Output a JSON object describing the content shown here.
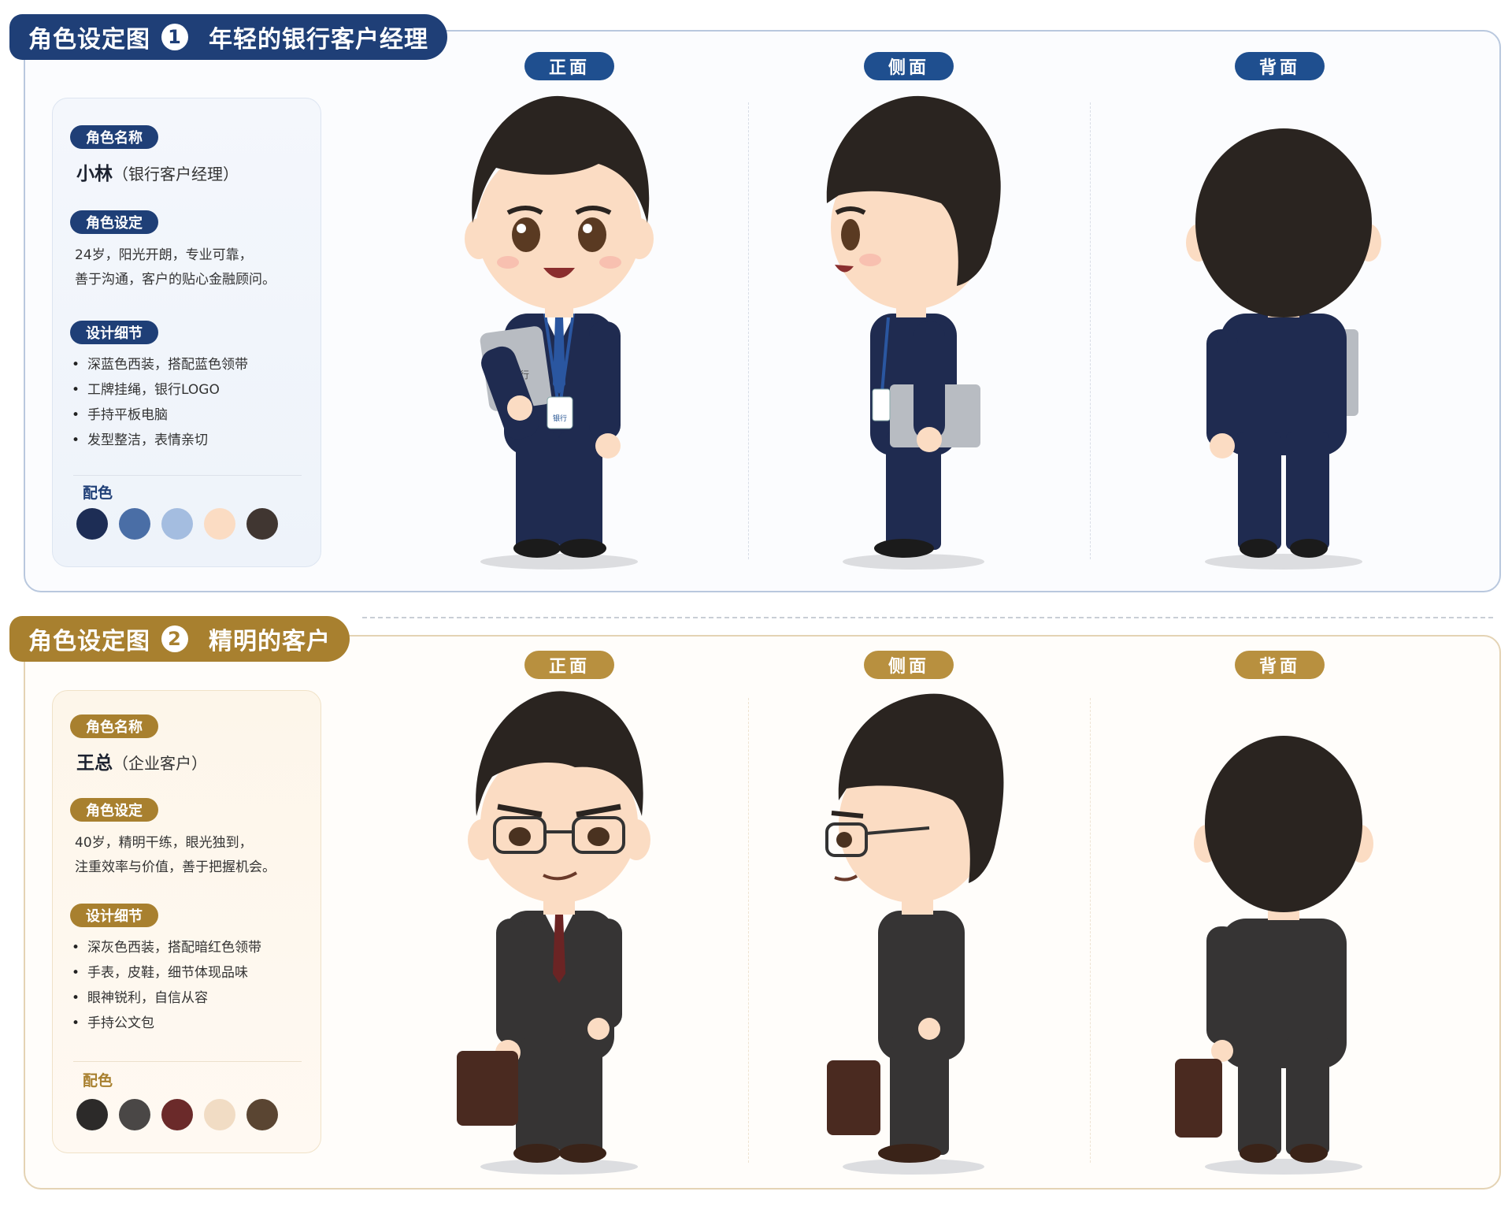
{
  "sheets": [
    {
      "title": "角色设定图",
      "number": "1",
      "subtitle": "年轻的银行客户经理",
      "name_label": "角色名称",
      "name": "小林",
      "name_paren": "（银行客户经理）",
      "setting_label": "角色设定",
      "setting_lines": [
        "24岁，阳光开朗，专业可靠，",
        "善于沟通，客户的贴心金融顾问。"
      ],
      "detail_label": "设计细节",
      "details": [
        "深蓝色西装，搭配蓝色领带",
        "工牌挂绳，银行LOGO",
        "手持平板电脑",
        "发型整洁，表情亲切"
      ],
      "palette_label": "配色",
      "palette": [
        "#1d2d55",
        "#4a6ea6",
        "#a4bde0",
        "#fbdcc3",
        "#403631"
      ],
      "views": [
        "正面",
        "侧面",
        "背面"
      ]
    },
    {
      "title": "角色设定图",
      "number": "2",
      "subtitle": "精明的客户",
      "name_label": "角色名称",
      "name": "王总",
      "name_paren": "（企业客户）",
      "setting_label": "角色设定",
      "setting_lines": [
        "40岁，精明干练，眼光独到，",
        "注重效率与价值，善于把握机会。"
      ],
      "detail_label": "设计细节",
      "details": [
        "深灰色西装，搭配暗红色领带",
        "手表，皮鞋，细节体现品味",
        "眼神锐利，自信从容",
        "手持公文包"
      ],
      "palette_label": "配色",
      "palette": [
        "#2c2a29",
        "#4a4746",
        "#6b2a2a",
        "#f1dcc4",
        "#5a4532"
      ],
      "views": [
        "正面",
        "侧面",
        "背面"
      ]
    }
  ],
  "figure_colors": {
    "hair": "#2a2420",
    "skin": "#fbdcc3",
    "suit1": "#1f2b50",
    "tie1": "#2a56a0",
    "suit2": "#363434",
    "tie2": "#6b2424",
    "shoe": "#1b1b1b",
    "bag": "#4a2a20",
    "tablet": "#b8bcc2"
  },
  "tablet_label": "银行",
  "badge_label": "银行"
}
